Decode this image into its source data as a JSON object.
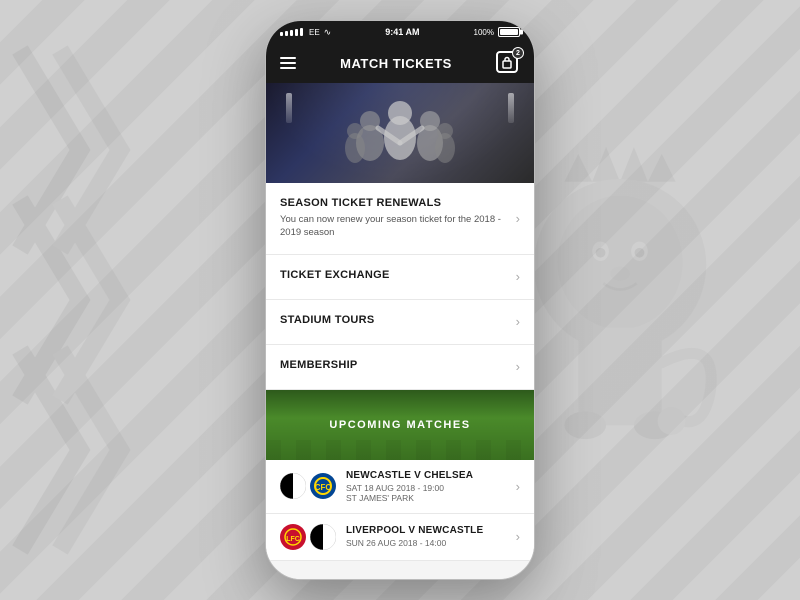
{
  "background": {
    "watermark_opacity": "0.18"
  },
  "statusBar": {
    "carrier": "EE",
    "time": "9:41 AM",
    "battery": "100%"
  },
  "navBar": {
    "title": "MATCH TICKETS",
    "cartCount": "2"
  },
  "menuItems": [
    {
      "id": "season-ticket-renewals",
      "title": "SEASON TICKET RENEWALS",
      "subtitle": "You can now renew your season ticket for the 2018 - 2019 season",
      "hasChevron": true
    },
    {
      "id": "ticket-exchange",
      "title": "TICKET EXCHANGE",
      "subtitle": "",
      "hasChevron": true
    },
    {
      "id": "stadium-tours",
      "title": "STADIUM TOURS",
      "subtitle": "",
      "hasChevron": true
    },
    {
      "id": "membership",
      "title": "MEMBERSHIP",
      "subtitle": "",
      "hasChevron": true
    }
  ],
  "upcomingSection": {
    "label": "UPCOMING MATCHES"
  },
  "matches": [
    {
      "id": "newcastle-chelsea",
      "home": "Newcastle",
      "away": "Chelsea",
      "name": "NEWCASTLE V CHELSEA",
      "date": "SAT 18 AUG 2018 - 19:00",
      "venue": "ST JAMES' PARK",
      "homeBadgeColor": "#000",
      "awayBadgeColor": "#034694"
    },
    {
      "id": "liverpool-newcastle",
      "home": "Liverpool",
      "away": "Newcastle",
      "name": "LIVERPOOL V NEWCASTLE",
      "date": "SUN 26 AUG 2018 - 14:00",
      "venue": "",
      "homeBadgeColor": "#C8102E",
      "awayBadgeColor": "#000"
    }
  ]
}
